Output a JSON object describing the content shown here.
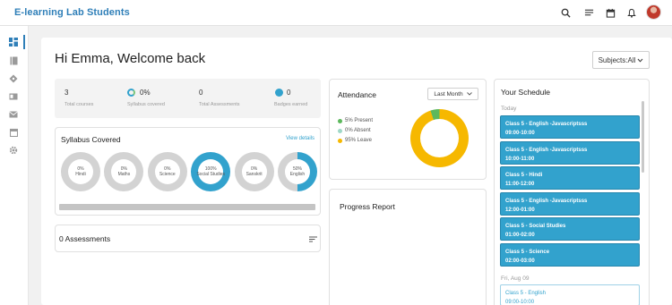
{
  "app": {
    "title": "E-learning Lab Students"
  },
  "topbar": {
    "icons": [
      "search-icon",
      "menu-icon",
      "calendar-icon",
      "bell-icon",
      "avatar"
    ]
  },
  "sidebar": {
    "items": [
      "dashboard-icon",
      "book-icon",
      "tag-icon",
      "id-card-icon",
      "mail-icon",
      "calendar-icon",
      "gear-icon"
    ]
  },
  "header": {
    "greeting": "Hi Emma, Welcome back",
    "subjects_select": "Subjects:All"
  },
  "stats": [
    {
      "value": "3",
      "label": "Total courses"
    },
    {
      "value": "0%",
      "label": "Syllabus covered"
    },
    {
      "value": "0",
      "label": "Total Assessments"
    },
    {
      "value": "0",
      "label": "Badges earned"
    }
  ],
  "syllabus": {
    "title": "Syllabus Covered",
    "view_details": "View details",
    "subjects": [
      {
        "name": "Hindi",
        "percent_label": "0%",
        "percent": 0
      },
      {
        "name": "Maths",
        "percent_label": "0%",
        "percent": 0
      },
      {
        "name": "Science",
        "percent_label": "0%",
        "percent": 0
      },
      {
        "name": "Social Studies",
        "percent_label": "100%",
        "percent": 100
      },
      {
        "name": "Sanskrit",
        "percent_label": "0%",
        "percent": 0
      },
      {
        "name": "English",
        "percent_label": "50%",
        "percent": 50
      }
    ]
  },
  "assessments": {
    "title": "0 Assessments"
  },
  "attendance": {
    "title": "Attendance",
    "period": "Last Month",
    "legend": [
      {
        "label": "5% Present",
        "value": 5,
        "color": "#5cb85c"
      },
      {
        "label": "0% Absent",
        "value": 0,
        "color": "#9fd8c8"
      },
      {
        "label": "95% Leave",
        "value": 95,
        "color": "#f6b800"
      }
    ]
  },
  "progress": {
    "title": "Progress Report"
  },
  "schedule": {
    "title": "Your Schedule",
    "today_label": "Today",
    "slots": [
      {
        "title": "Class 5 - English -Javascriptsss",
        "time": "09:00-10:00"
      },
      {
        "title": "Class 5 - English -Javascriptsss",
        "time": "10:00-11:00"
      },
      {
        "title": "Class 5 - Hindi",
        "time": "11:00-12:00"
      },
      {
        "title": "Class 5 - English -Javascriptsss",
        "time": "12:00-01:00"
      },
      {
        "title": "Class 5 - Social Studies",
        "time": "01:00-02:00"
      },
      {
        "title": "Class 5 - Science",
        "time": "02:00-03:00"
      }
    ],
    "next_day_label": "Fri, Aug 09",
    "next_slot": {
      "title": "Class 5 - English",
      "time": "09:00-10:00"
    }
  },
  "colors": {
    "brand": "#2f7fb8",
    "accent": "#32a2cd",
    "ring_empty": "#d3d3d3",
    "leave": "#f6b800",
    "present": "#5cb85c"
  }
}
